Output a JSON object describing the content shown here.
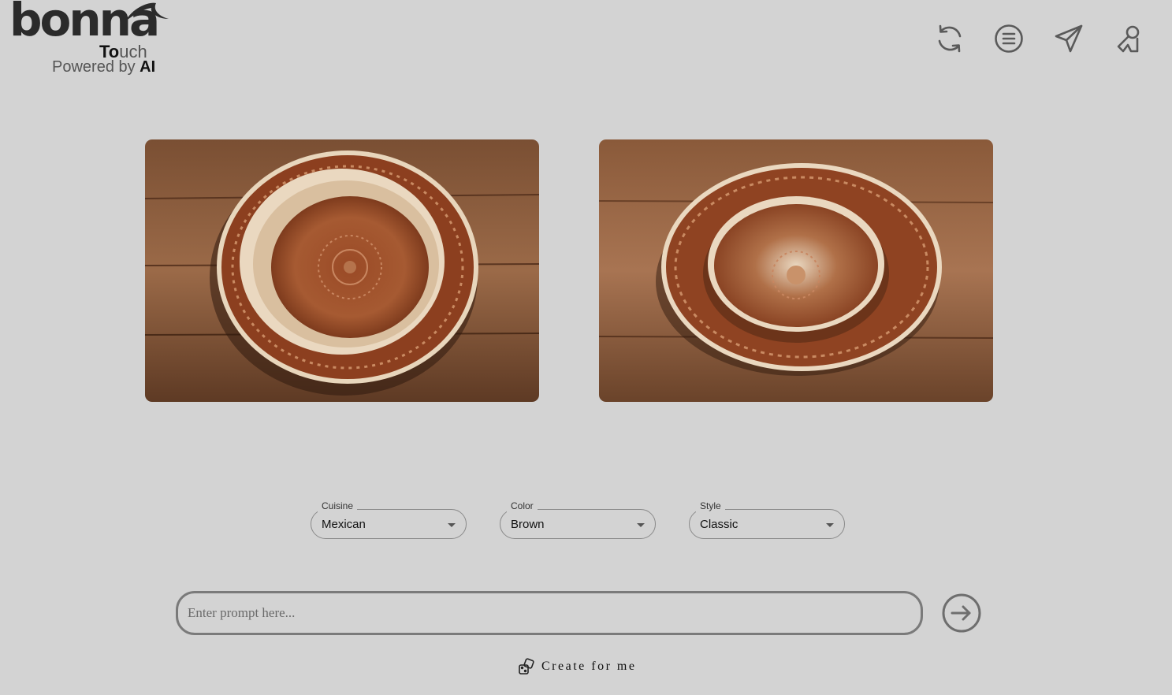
{
  "brand": {
    "wordmark": "bonna",
    "touch_prefix": "To",
    "touch_suffix": "uch",
    "tagline_prefix": "Powered by ",
    "tagline_bold": "AI"
  },
  "toolbar": {
    "icons": [
      "refresh-icon",
      "menu-icon",
      "send-icon",
      "user-icon"
    ]
  },
  "gallery": {
    "images": [
      {
        "name": "plate-image-1",
        "colors": [
          "#a3592f",
          "#e6d2b6",
          "#7a4a2b"
        ]
      },
      {
        "name": "plate-image-2",
        "colors": [
          "#9b4e2c",
          "#ead8c0",
          "#8a5534"
        ]
      }
    ]
  },
  "filters": {
    "cuisine": {
      "label": "Cuisine",
      "value": "Mexican"
    },
    "color": {
      "label": "Color",
      "value": "Brown"
    },
    "style": {
      "label": "Style",
      "value": "Classic"
    }
  },
  "prompt": {
    "placeholder": "Enter prompt here...",
    "value": ""
  },
  "create": {
    "label": "Create for me",
    "icon": "dice-icon"
  },
  "colors": {
    "background": "#d3d3d3",
    "icon": "#5a5a5a",
    "border": "#7a7a7a"
  }
}
